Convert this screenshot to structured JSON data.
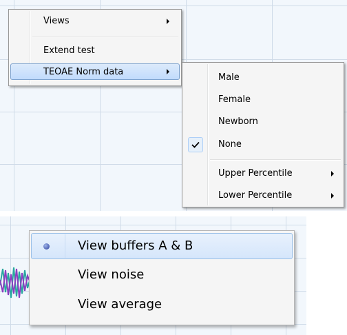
{
  "context_menu": {
    "items": [
      {
        "label": "Views",
        "has_submenu": true
      },
      {
        "label": "Extend test",
        "has_submenu": false
      },
      {
        "label": "TEOAE Norm data",
        "has_submenu": true,
        "highlighted": true
      }
    ]
  },
  "norm_submenu": {
    "items": [
      {
        "label": "Male",
        "checked": false
      },
      {
        "label": "Female",
        "checked": false
      },
      {
        "label": "Newborn",
        "checked": false
      },
      {
        "label": "None",
        "checked": true
      },
      {
        "label": "Upper Percentile",
        "has_submenu": true
      },
      {
        "label": "Lower Percentile",
        "has_submenu": true
      }
    ]
  },
  "view_menu": {
    "items": [
      {
        "label": "View buffers A & B",
        "selected": true,
        "highlighted": true
      },
      {
        "label": "View noise",
        "selected": false
      },
      {
        "label": "View average",
        "selected": false
      }
    ]
  },
  "colors": {
    "grid_background": "#f2f7fc",
    "grid_line": "#cfdbe8",
    "highlight_border": "#7da2ce",
    "waveform_teal": "#2aa7a0",
    "waveform_purple": "#8a3ec0"
  }
}
